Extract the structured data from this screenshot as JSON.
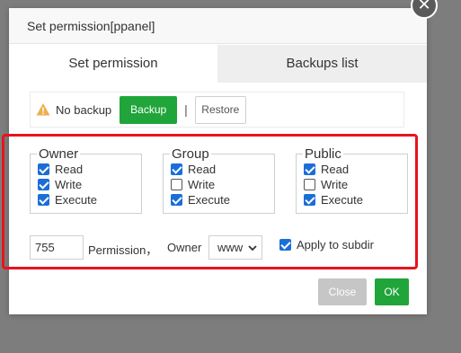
{
  "dialog": {
    "title": "Set permission[ppanel]",
    "close_glyph": "✕"
  },
  "tabs": [
    {
      "label": "Set permission",
      "active": true
    },
    {
      "label": "Backups list",
      "active": false
    }
  ],
  "backup": {
    "status": "No backup",
    "backup_label": "Backup",
    "separator": "|",
    "restore_label": "Restore",
    "warn_color": "#f0ad4e",
    "accent": "#20a53a"
  },
  "groups": [
    {
      "title": "Owner",
      "read": "Read",
      "write": "Write",
      "execute": "Execute",
      "read_on": true,
      "write_on": true,
      "execute_on": true
    },
    {
      "title": "Group",
      "read": "Read",
      "write": "Write",
      "execute": "Execute",
      "read_on": true,
      "write_on": false,
      "execute_on": true
    },
    {
      "title": "Public",
      "read": "Read",
      "write": "Write",
      "execute": "Execute",
      "read_on": true,
      "write_on": false,
      "execute_on": true
    }
  ],
  "permission": {
    "value": "755",
    "label": "Permission，"
  },
  "owner": {
    "label": "Owner",
    "value": "www"
  },
  "apply": {
    "label": "Apply to subdir",
    "checked": true
  },
  "footer": {
    "close_label": "Close",
    "ok_label": "OK"
  },
  "highlight_color": "#e8141c"
}
